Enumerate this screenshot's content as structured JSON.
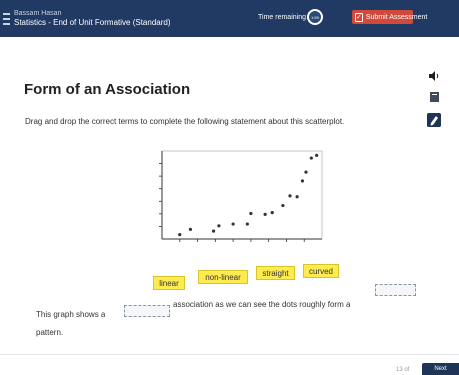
{
  "header": {
    "student_name": "Bassam Hasan",
    "assessment_title": "Statistics - End of Unit Formative (Standard)",
    "time_label": "Time remaining",
    "timer_value": "1:59",
    "submit_label": "Submit Assessment"
  },
  "question": {
    "title": "Form of an Association",
    "instruction": "Drag and drop the correct terms to complete the following statement about this scatterplot."
  },
  "toolbar": {
    "icons": [
      "audio-icon",
      "bookmark-icon",
      "pencil-icon"
    ]
  },
  "scatterplot": {
    "x_ticks": 8,
    "y_ticks": 6,
    "points": [
      [
        1.0,
        0.25
      ],
      [
        1.6,
        0.55
      ],
      [
        2.9,
        0.45
      ],
      [
        3.2,
        0.75
      ],
      [
        4.0,
        0.85
      ],
      [
        4.8,
        0.85
      ],
      [
        5.0,
        1.45
      ],
      [
        5.8,
        1.4
      ],
      [
        6.2,
        1.5
      ],
      [
        6.8,
        1.9
      ],
      [
        7.2,
        2.45
      ],
      [
        7.6,
        2.4
      ],
      [
        7.9,
        3.3
      ],
      [
        8.1,
        3.8
      ],
      [
        8.4,
        4.6
      ],
      [
        8.7,
        4.75
      ]
    ]
  },
  "terms": [
    "linear",
    "non-linear",
    "straight",
    "curved"
  ],
  "statement": {
    "before": "This graph shows a",
    "middle": "association as we can see the dots roughly form a",
    "after": "pattern."
  },
  "footer": {
    "page_indicator": "13 of",
    "next_label": "Next"
  }
}
